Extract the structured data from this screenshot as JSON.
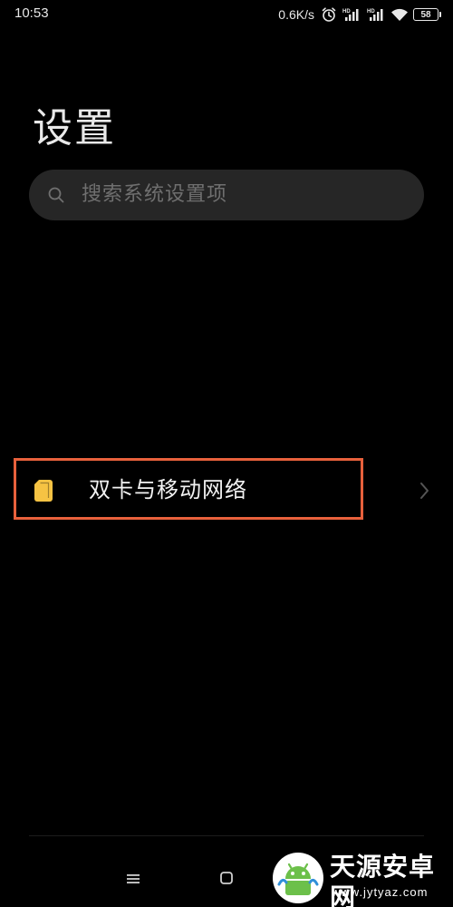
{
  "status_bar": {
    "time": "10:53",
    "net_speed": "0.6K/s",
    "battery": "58",
    "icons": [
      "alarm-icon",
      "hd-signal-icon",
      "hd-signal-icon",
      "wifi-icon",
      "battery-icon"
    ]
  },
  "header": {
    "title": "设置"
  },
  "search": {
    "placeholder": "搜索系统设置项"
  },
  "settings": {
    "items": [
      {
        "icon": "sim-card-icon",
        "label": "双卡与移动网络",
        "highlighted": true
      }
    ]
  },
  "navigation": {
    "buttons": [
      "menu-icon",
      "home-icon"
    ]
  },
  "watermark": {
    "name": "天源安卓网",
    "url": "www.jytyaz.com"
  },
  "colors": {
    "background": "#000000",
    "search_bg": "#262626",
    "highlight_border": "#e8613c",
    "sim_icon": "#f6c343"
  }
}
